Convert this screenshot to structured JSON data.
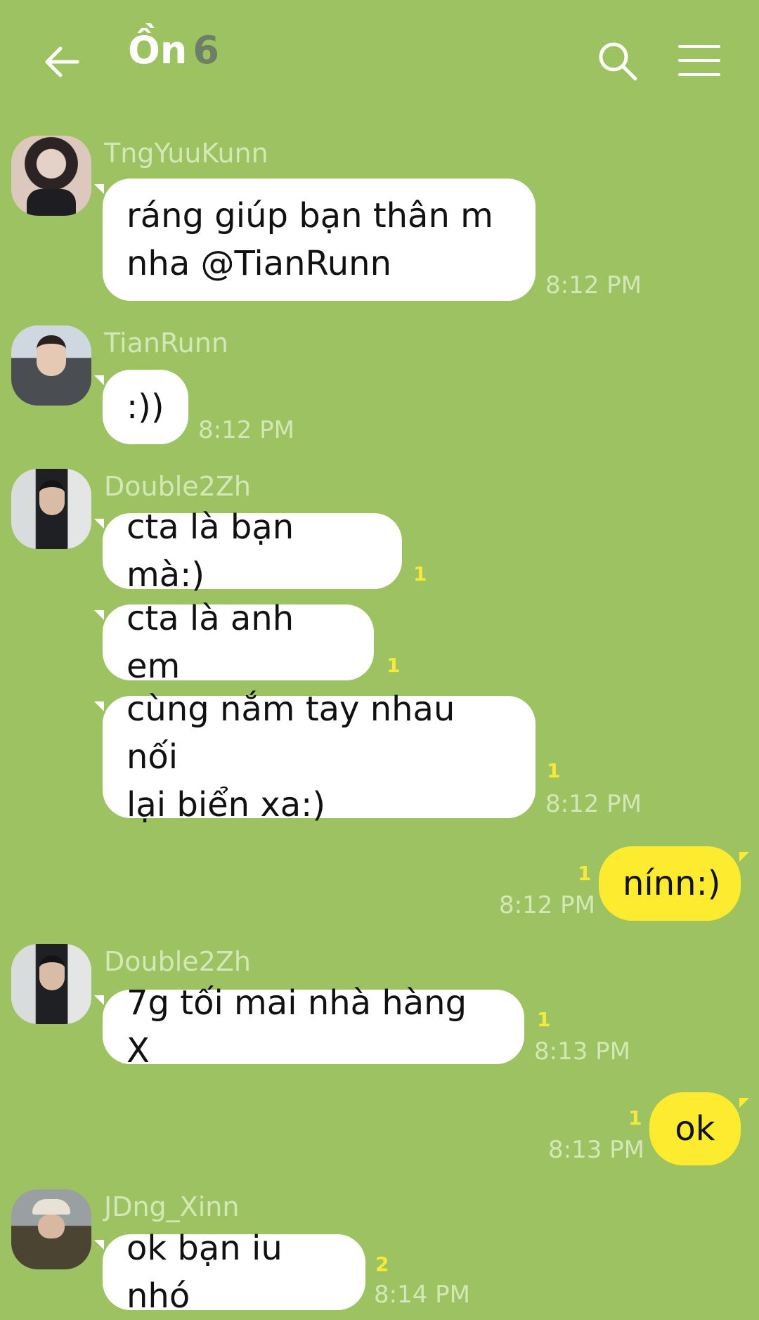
{
  "header": {
    "title": "Ồn",
    "member_count": "6",
    "icons": {
      "back": "arrow-left-icon",
      "search": "search-icon",
      "menu": "menu-icon"
    }
  },
  "colors": {
    "background": "#9cc262",
    "incoming_bubble": "#ffffff",
    "outgoing_bubble": "#fdeb2f",
    "unread_count": "#f7e83b",
    "meta_text": "#d4e7b6"
  },
  "messages": [
    {
      "sender": "TngYuuKunn",
      "text": "ráng giúp bạn thân m\nnha @TianRunn",
      "time": "8:12 PM"
    },
    {
      "sender": "TianRunn",
      "text": ":))",
      "time": "8:12 PM"
    },
    {
      "sender": "Double2Zh",
      "text": "cta là bạn mà:)",
      "unread": "1"
    },
    {
      "text": "cta là anh em",
      "unread": "1"
    },
    {
      "text": "cùng nắm tay nhau nối\nlại biển xa:)",
      "unread": "1",
      "time": "8:12 PM"
    },
    {
      "text": "nínn:)",
      "unread": "1",
      "time": "8:12 PM"
    },
    {
      "sender": "Double2Zh",
      "text": "7g tối mai nhà hàng X",
      "unread": "1",
      "time": "8:13 PM"
    },
    {
      "text": "ok",
      "unread": "1",
      "time": "8:13 PM"
    },
    {
      "sender": "JDng_Xinn",
      "text": "ok bạn iu nhó",
      "unread": "2",
      "time": "8:14 PM"
    }
  ]
}
